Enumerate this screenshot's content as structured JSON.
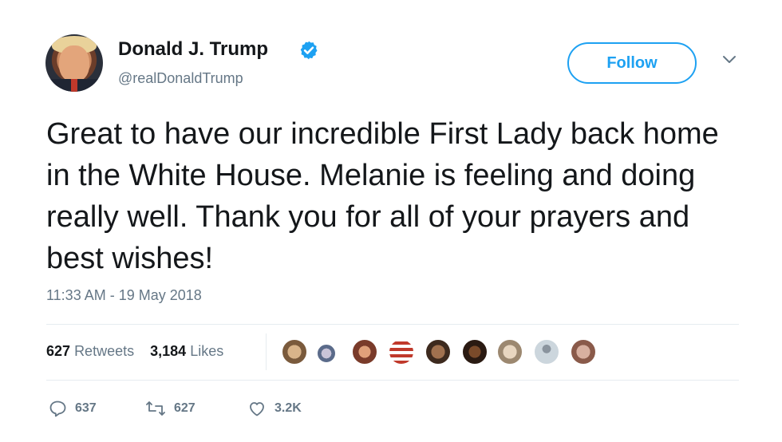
{
  "user": {
    "display_name": "Donald J. Trump",
    "handle": "@realDonaldTrump",
    "verified": true,
    "avatar": "profile-photo"
  },
  "follow_button": {
    "label": "Follow"
  },
  "tweet": {
    "text": "Great to have our incredible First Lady back home in the White House. Melanie is feeling and doing really well. Thank you for all of your prayers and best wishes!",
    "timestamp": "11:33 AM - 19 May 2018"
  },
  "stats": {
    "retweets_count": "627",
    "retweets_label": "Retweets",
    "likes_count": "3,184",
    "likes_label": "Likes",
    "liker_avatar_count": 10
  },
  "actions": {
    "reply_count": "637",
    "retweet_count": "627",
    "like_count": "3.2K"
  },
  "colors": {
    "accent": "#1da1f2",
    "secondary_text": "#657786",
    "primary_text": "#14171a",
    "divider": "#e6ecf0"
  },
  "icons": [
    "verified-badge-icon",
    "chevron-down-icon",
    "reply-icon",
    "retweet-icon",
    "like-icon"
  ]
}
